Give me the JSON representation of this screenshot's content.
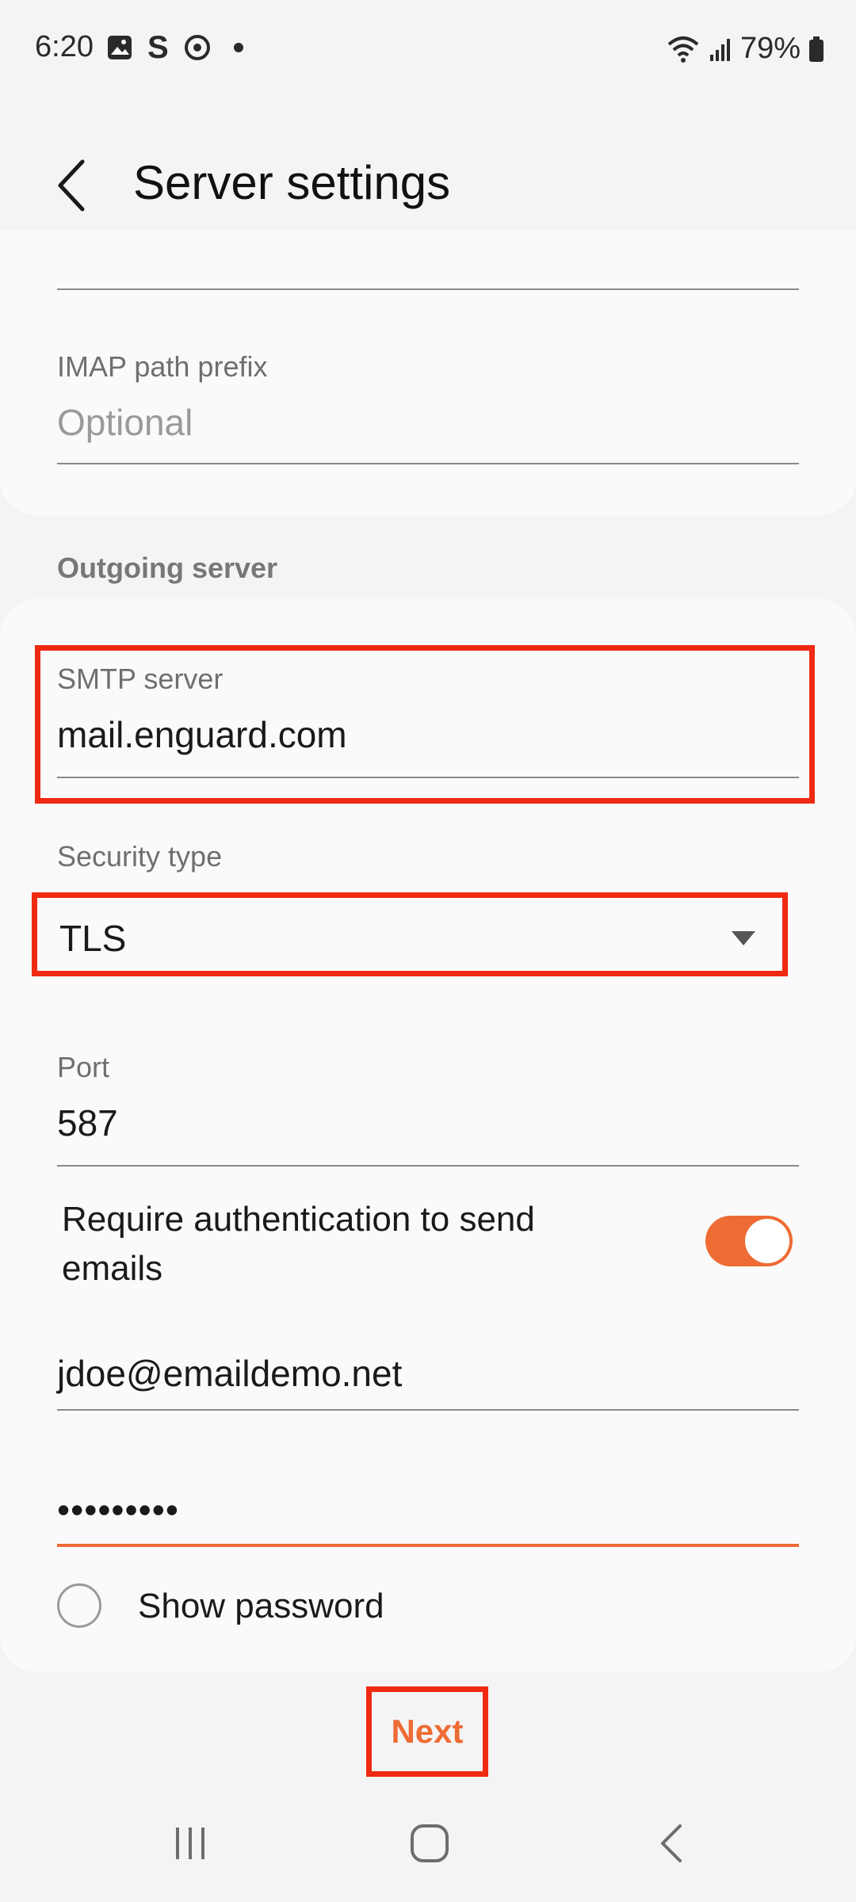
{
  "status_bar": {
    "time": "6:20",
    "battery": "79%",
    "left_icons": [
      "image-icon",
      "s-app-icon",
      "sync-icon",
      "dot-icon"
    ],
    "right_icons": [
      "wifi-icon",
      "signal-icon",
      "battery-icon"
    ]
  },
  "header": {
    "title": "Server settings",
    "back_icon": "back-chevron-icon"
  },
  "incoming": {
    "imap_path_prefix_label": "IMAP path prefix",
    "imap_path_prefix_placeholder": "Optional"
  },
  "outgoing": {
    "section_title": "Outgoing server",
    "smtp_label": "SMTP server",
    "smtp_value": "mail.enguard.com",
    "security_label": "Security type",
    "security_value": "TLS",
    "port_label": "Port",
    "port_value": "587",
    "require_auth_label": "Require authentication to send emails",
    "require_auth_on": true,
    "username_value": "jdoe@emaildemo.net",
    "password_value": "•••••••••",
    "show_password_label": "Show password",
    "show_password_checked": false
  },
  "actions": {
    "next_label": "Next"
  },
  "nav": {
    "icons": [
      "recent-apps-icon",
      "home-icon",
      "back-icon"
    ]
  },
  "colors": {
    "accent": "#ee6b34",
    "highlight": "#f02a12"
  }
}
